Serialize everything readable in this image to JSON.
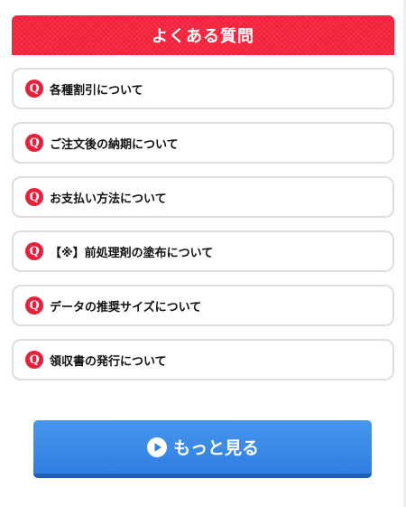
{
  "header": {
    "title": "よくある質問"
  },
  "faq": {
    "q_icon": "Q",
    "items": [
      {
        "label": "各種割引について"
      },
      {
        "label": "ご注文後の納期について"
      },
      {
        "label": "お支払い方法について"
      },
      {
        "label": "【※】前処理剤の塗布について"
      },
      {
        "label": "データの推奨サイズについて"
      },
      {
        "label": "領収書の発行について"
      }
    ]
  },
  "more_button": {
    "label": "もっと見る",
    "icon": "play-circle-icon"
  },
  "colors": {
    "header_red": "#f2213b",
    "q_icon_red": "#e8203e",
    "button_blue": "#3a89e8",
    "border_gray": "#dedede"
  }
}
